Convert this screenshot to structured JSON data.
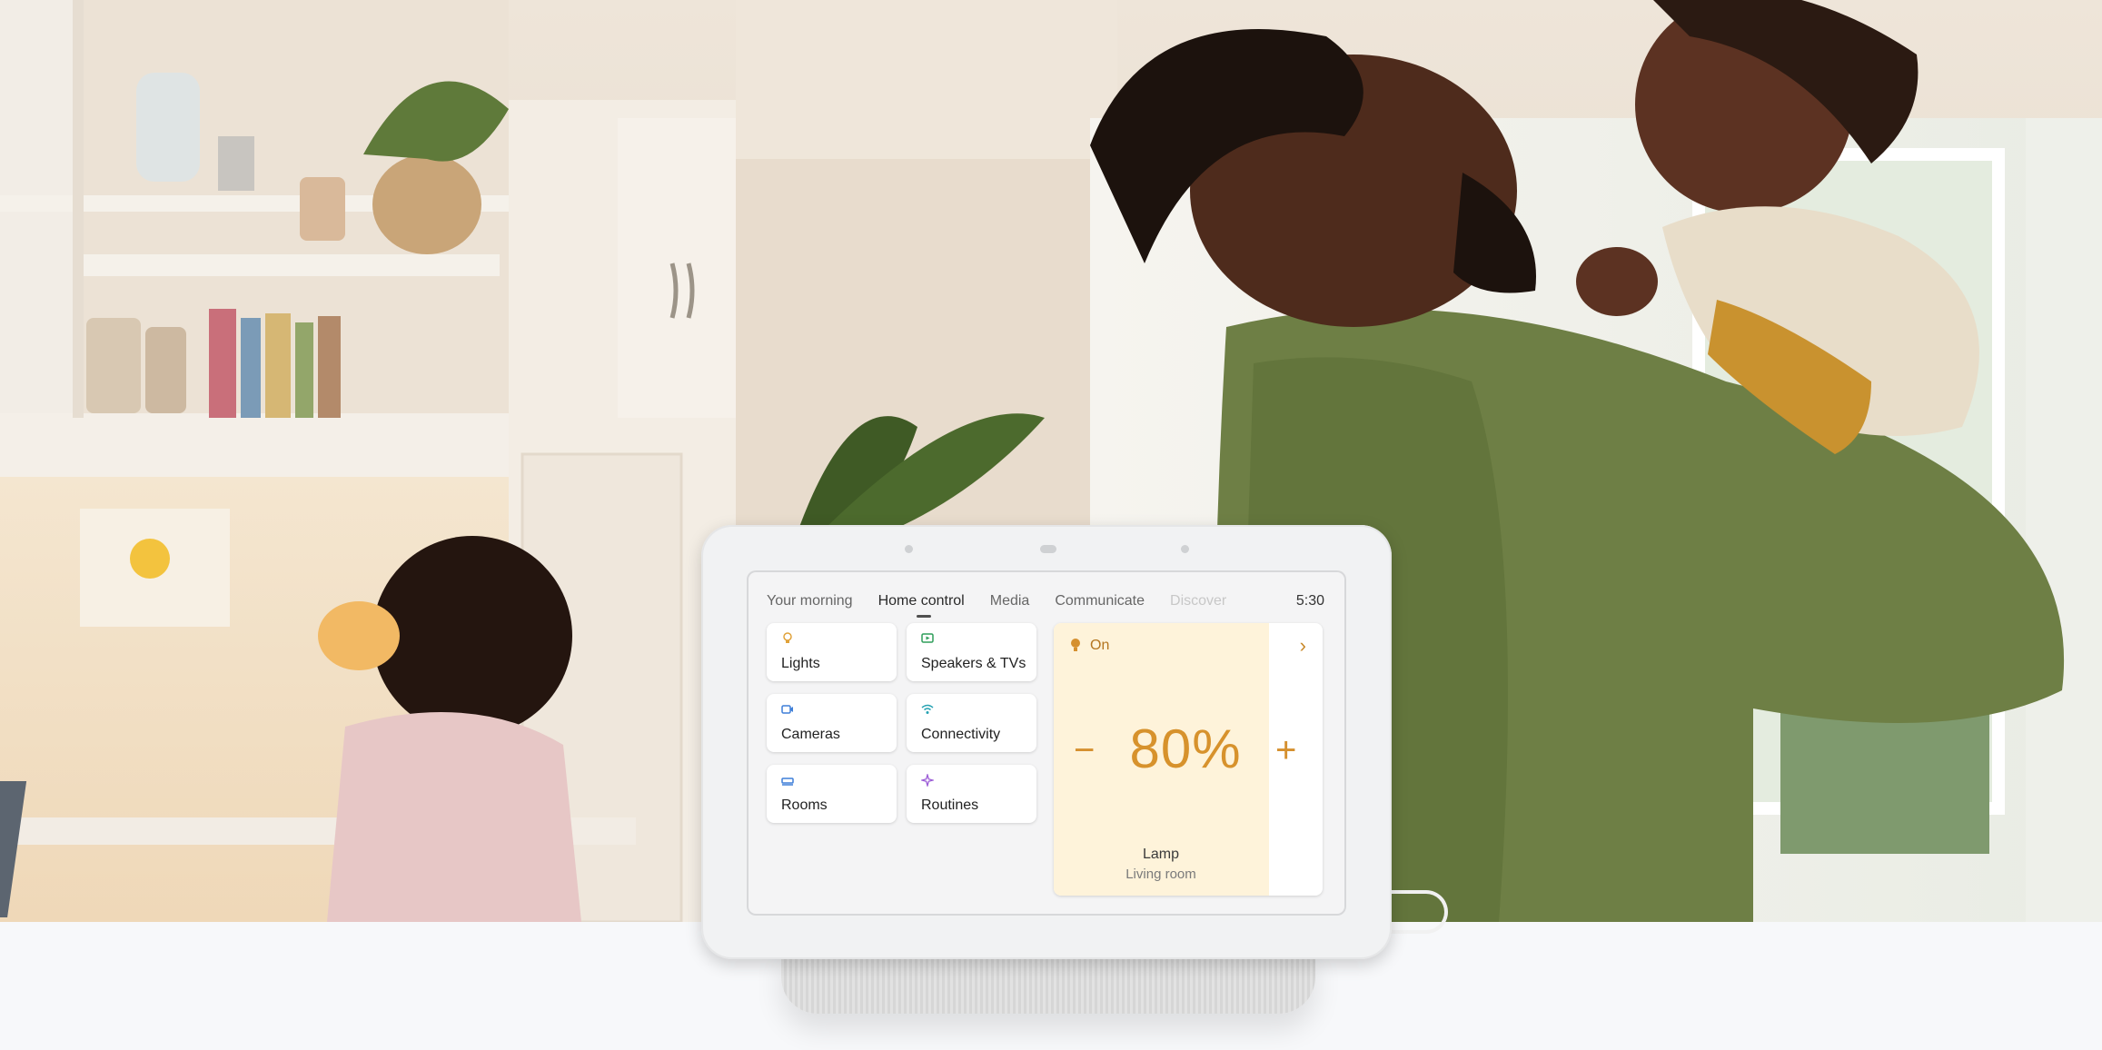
{
  "hub": {
    "tabs": [
      {
        "label": "Your morning"
      },
      {
        "label": "Home control"
      },
      {
        "label": "Media"
      },
      {
        "label": "Communicate"
      },
      {
        "label": "Discover"
      }
    ],
    "clock": "5:30",
    "tiles": [
      {
        "label": "Lights",
        "icon": "lightbulb-icon"
      },
      {
        "label": "Speakers & TVs",
        "icon": "speaker-tv-icon"
      },
      {
        "label": "Cameras",
        "icon": "camera-icon"
      },
      {
        "label": "Connectivity",
        "icon": "wifi-icon"
      },
      {
        "label": "Rooms",
        "icon": "bed-icon"
      },
      {
        "label": "Routines",
        "icon": "sparkle-icon"
      }
    ],
    "lamp": {
      "state": "On",
      "brightness": "80%",
      "brightness_fraction": 0.8,
      "minus": "−",
      "plus": "+",
      "chevron": "›",
      "name": "Lamp",
      "room": "Living room"
    }
  },
  "colors": {
    "accent": "#d7922c",
    "lamp_fill": "#fef3da",
    "background_band": "#f7f8fa"
  }
}
